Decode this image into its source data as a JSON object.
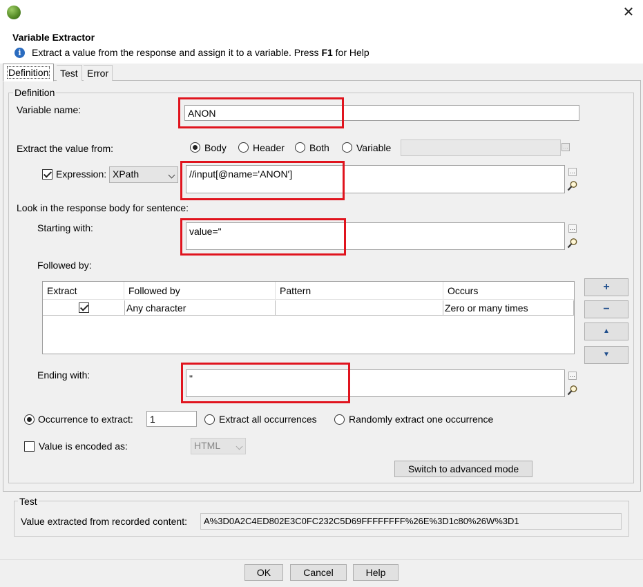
{
  "window": {
    "close_glyph": "✕"
  },
  "header": {
    "title": "Variable Extractor",
    "info_prefix": "Extract a value from the response and assign it to a variable. Press ",
    "info_key": "F1",
    "info_suffix": " for Help"
  },
  "tabs": [
    {
      "label": "Definition",
      "active": true
    },
    {
      "label": "Test",
      "active": false
    },
    {
      "label": "Error",
      "active": false
    }
  ],
  "definition": {
    "group_label": "Definition",
    "variable_name_label": "Variable name:",
    "variable_name_value": "ANON",
    "extract_from_label": "Extract the value from:",
    "source_options": [
      {
        "label": "Body",
        "selected": true
      },
      {
        "label": "Header",
        "selected": false
      },
      {
        "label": "Both",
        "selected": false
      },
      {
        "label": "Variable",
        "selected": false
      }
    ],
    "variable_source_value": "",
    "expression_label": "Expression:",
    "expression_checked": true,
    "expression_type": "XPath",
    "expression_value": "//input[@name='ANON']",
    "look_in_label": "Look in the response body for sentence:",
    "starting_with_label": "Starting with:",
    "starting_with_value": "value=\"",
    "followed_by_label": "Followed by:",
    "followed_table": {
      "columns": [
        "Extract",
        "Followed by",
        "Pattern",
        "Occurs"
      ],
      "rows": [
        {
          "extract": true,
          "followed_by": "Any character",
          "pattern": "",
          "occurs": "Zero or many times"
        }
      ]
    },
    "side_buttons": {
      "add": "+",
      "remove": "−",
      "up": "▲",
      "down": "▼"
    },
    "ending_with_label": "Ending with:",
    "ending_with_value": "\"",
    "occurrence_label": "Occurrence to extract:",
    "occurrence_value": "1",
    "occurrence_selected": true,
    "extract_all_label": "Extract all occurrences",
    "random_label": "Randomly extract one occurrence",
    "encoded_label": "Value is encoded as:",
    "encoded_checked": false,
    "encoding_value": "HTML",
    "advanced_button": "Switch to advanced mode",
    "dots_glyph": "..."
  },
  "test": {
    "group_label": "Test",
    "extracted_label": "Value extracted from recorded content:",
    "extracted_value": "A%3D0A2C4ED802E3C0FC232C5D69FFFFFFFF%26E%3D1c80%26W%3D1"
  },
  "footer": {
    "ok": "OK",
    "cancel": "Cancel",
    "help": "Help"
  },
  "colors": {
    "highlight": "#e0141e",
    "accent": "#1f4e8c"
  }
}
